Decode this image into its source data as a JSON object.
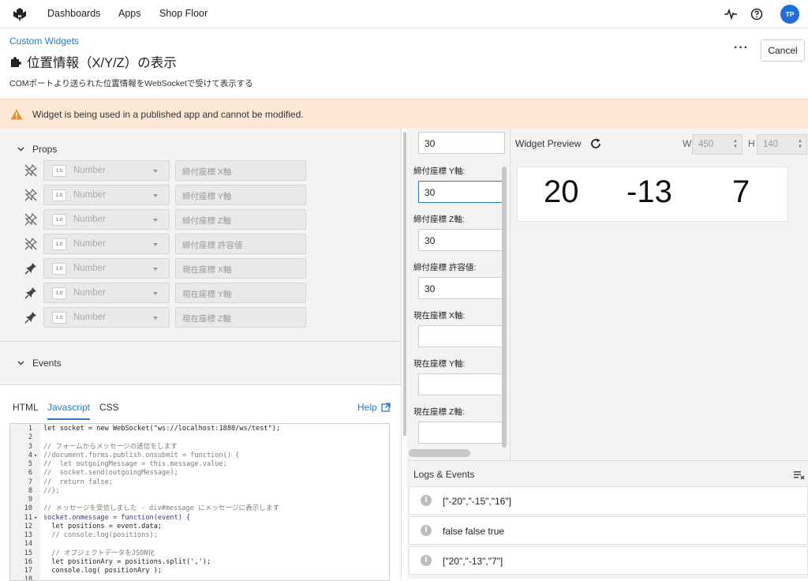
{
  "nav": {
    "items": [
      "Dashboards",
      "Apps",
      "Shop Floor"
    ],
    "avatar": "TP"
  },
  "breadcrumb": "Custom Widgets",
  "title": "位置情報（X/Y/Z）の表示",
  "description": "COMポートより送られた位置情報をWebSocketで受けて表示する",
  "actions": {
    "more": "···",
    "cancel": "Cancel"
  },
  "warning": "Widget is being used in a published app and cannot be modified.",
  "props": {
    "header": "Props",
    "rows": [
      {
        "type_badge": "1.0",
        "type": "Number",
        "name": "締付座標 X軸",
        "pinned": false
      },
      {
        "type_badge": "1.0",
        "type": "Number",
        "name": "締付座標 Y軸",
        "pinned": false
      },
      {
        "type_badge": "1.0",
        "type": "Number",
        "name": "締付座標 Z軸",
        "pinned": false
      },
      {
        "type_badge": "1.0",
        "type": "Number",
        "name": "締付座標 許容値",
        "pinned": false
      },
      {
        "type_badge": "1.0",
        "type": "Number",
        "name": "現在座標 X軸",
        "pinned": true
      },
      {
        "type_badge": "1.0",
        "type": "Number",
        "name": "現在座標 Y軸",
        "pinned": true
      },
      {
        "type_badge": "1.0",
        "type": "Number",
        "name": "現在座標 Z軸",
        "pinned": true
      }
    ]
  },
  "events": {
    "header": "Events"
  },
  "editor": {
    "tabs": [
      "HTML",
      "Javascript",
      "CSS"
    ],
    "active_tab": "Javascript",
    "help": "Help",
    "lines": [
      {
        "n": "1",
        "t": "let socket = new WebSocket(\"ws://localhost:1880/ws/test\");",
        "k": "plain"
      },
      {
        "n": "2",
        "t": "",
        "k": "plain"
      },
      {
        "n": "3",
        "t": "// フォームからメッセージの送信をします",
        "k": "comment"
      },
      {
        "n": "4",
        "t": "//document.forms.publish.onsubmit = function() {",
        "k": "comment",
        "fold": true
      },
      {
        "n": "5",
        "t": "//  let outgoingMessage = this.message.value;",
        "k": "comment"
      },
      {
        "n": "6",
        "t": "//  socket.send(outgoingMessage);",
        "k": "comment"
      },
      {
        "n": "7",
        "t": "//  return false;",
        "k": "comment"
      },
      {
        "n": "8",
        "t": "//};",
        "k": "comment"
      },
      {
        "n": "9",
        "t": "",
        "k": "plain"
      },
      {
        "n": "10",
        "t": "// メッセージを受信しました - div#message にメッセージに表示します",
        "k": "comment"
      },
      {
        "n": "11",
        "t": "socket.onmessage = function(event) {",
        "k": "kw",
        "fold": true
      },
      {
        "n": "12",
        "t": "  let positions = event.data;",
        "k": "plain"
      },
      {
        "n": "13",
        "t": "  // console.log(positions);",
        "k": "comment"
      },
      {
        "n": "14",
        "t": "",
        "k": "plain"
      },
      {
        "n": "15",
        "t": "  // オブジェクトデータをJSON化",
        "k": "comment"
      },
      {
        "n": "16",
        "t": "  let positionAry = positions.split(',');",
        "k": "plain"
      },
      {
        "n": "17",
        "t": "  console.log( positionAry );",
        "k": "plain"
      },
      {
        "n": "18",
        "t": "",
        "k": "plain"
      }
    ]
  },
  "fields": {
    "first_value": "30",
    "items": [
      {
        "label": "締付座標 Y軸:",
        "value": "30"
      },
      {
        "label": "締付座標 Z軸:",
        "value": "30"
      },
      {
        "label": "締付座標 許容値:",
        "value": "30"
      },
      {
        "label": "現在座標 X軸:",
        "value": ""
      },
      {
        "label": "現在座標 Y軸:",
        "value": ""
      },
      {
        "label": "現在座標 Z軸:",
        "value": ""
      }
    ]
  },
  "preview": {
    "header": "Widget Preview",
    "w_label": "W",
    "w_value": "450",
    "h_label": "H",
    "h_value": "140",
    "values": [
      "20",
      "-13",
      "7"
    ]
  },
  "logs": {
    "header": "Logs & Events",
    "entries": [
      "[\"-20\",\"-15\",\"16\"]",
      "false false true",
      "[\"20\",\"-13\",\"7\"]"
    ]
  },
  "colors": {
    "accent": "#2a7ac7",
    "warning_bg": "#fde8d5",
    "warning_icon": "#e8902e",
    "avatar": "#1f6fd6"
  }
}
